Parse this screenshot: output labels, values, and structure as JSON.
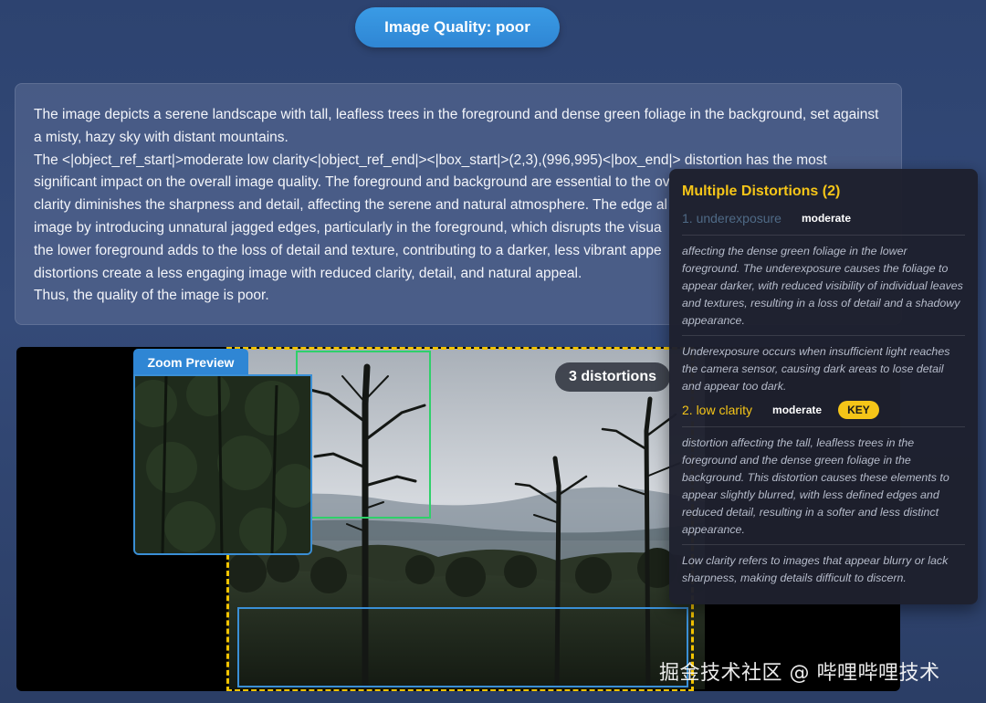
{
  "header": {
    "quality_label": "Image Quality: poor"
  },
  "description": {
    "lines": [
      "The image depicts a serene landscape with tall, leafless trees in the foreground and dense green foliage in the background, set against",
      "a misty, hazy sky with distant mountains.",
      "The <|object_ref_start|>moderate low clarity<|object_ref_end|><|box_start|>(2,3),(996,995)<|box_end|> distortion has the most",
      "significant impact on the overall image quality. The foreground and background are essential to the ov",
      "clarity diminishes the sharpness and detail, affecting the serene and natural atmosphere. The edge al",
      "image by introducing unnatural jagged edges, particularly in the foreground, which disrupts the visua",
      "the lower foreground adds to the loss of detail and texture, contributing to a darker, less vibrant appe",
      "distortions create a less engaging image with reduced clarity, detail, and natural appeal.",
      "Thus, the quality of the image is poor."
    ]
  },
  "viewer": {
    "zoom_label": "Zoom Preview",
    "distortion_count": "3 distortions"
  },
  "tooltip": {
    "title": "Multiple Distortions (2)",
    "items": [
      {
        "name": "1. underexposure",
        "severity": "moderate",
        "detail": "affecting the dense green foliage in the lower foreground. The underexposure causes the foliage to appear darker, with reduced visibility of individual leaves and textures, resulting in a loss of detail and a shadowy appearance.",
        "definition": "Underexposure occurs when insufficient light reaches the camera sensor, causing dark areas to lose detail and appear too dark."
      },
      {
        "name": "2. low clarity",
        "severity": "moderate",
        "badge": "KEY",
        "detail": "distortion affecting the tall, leafless trees in the foreground and the dense green foliage in the background. This distortion causes these elements to appear slightly blurred, with less defined edges and reduced detail, resulting in a softer and less distinct appearance.",
        "definition": "Low clarity refers to images that appear blurry or lack sharpness, making details difficult to discern."
      }
    ],
    "colors": {
      "accent": "#f5c518",
      "dim": "#4f6a86"
    }
  },
  "watermark": "掘金技术社区 @ 哔哩哔哩技术"
}
